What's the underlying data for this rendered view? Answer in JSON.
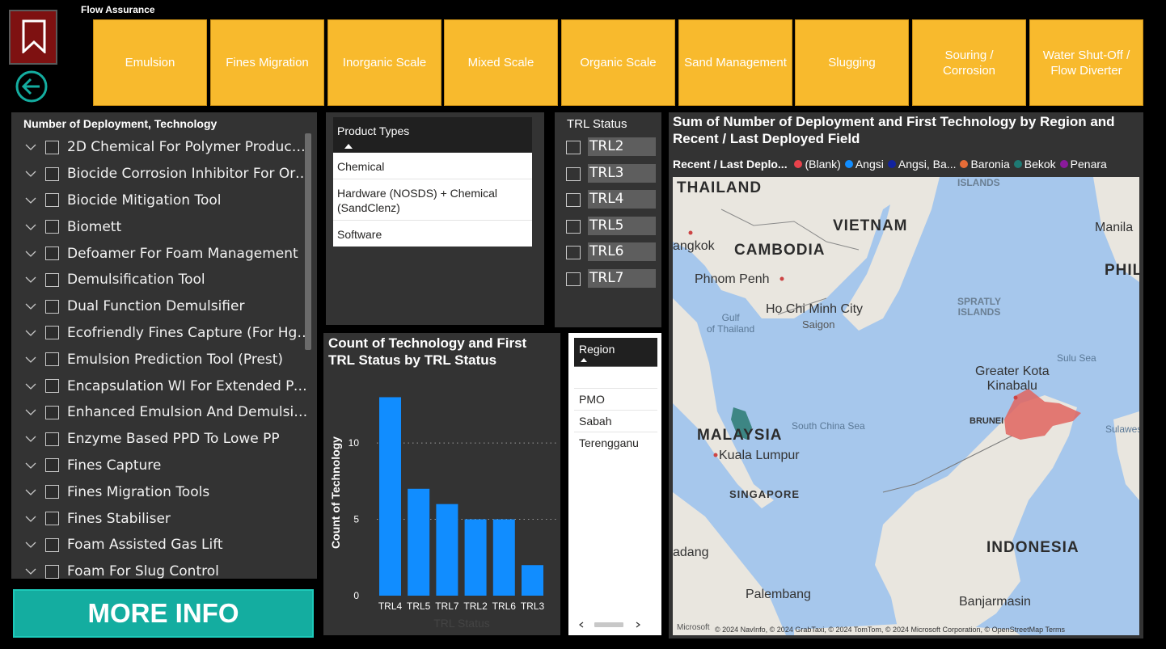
{
  "header": {
    "section_label": "Flow Assurance",
    "tiles": [
      "Emulsion",
      "Fines Migration",
      "Inorganic Scale",
      "Mixed Scale",
      "Organic Scale",
      "Sand Management",
      "Slugging",
      "Souring / Corrosion",
      "Water Shut-Off / Flow Diverter"
    ]
  },
  "icons": {
    "logo": "bookmark-icon",
    "back": "back-arrow-icon"
  },
  "colors": {
    "tile": "#f8ba2d",
    "accent": "#14ada0",
    "bar": "#118dff",
    "panel": "#333333"
  },
  "tech_slicer": {
    "title": "Number of Deployment, Technology",
    "items": [
      "2D Chemical For Polymer Produced ...",
      "Biocide Corrosion Inhibitor For Orga...",
      "Biocide Mitigation Tool",
      "Biomett",
      "Defoamer For Foam Management",
      "Demulsification Tool",
      "Dual Function Demulsifier",
      "Ecofriendly Fines Capture (For Hgs P...",
      "Emulsion Prediction Tool (Prest)",
      "Encapsulation WI For Extended Perf...",
      "Enhanced Emulsion And Demulsifica...",
      "Enzyme Based PPD To Lowe PP",
      "Fines Capture",
      "Fines Migration Tools",
      "Fines Stabiliser",
      "Foam Assisted Gas Lift",
      "Foam For Slug Control"
    ]
  },
  "more_info": {
    "label": "MORE INFO"
  },
  "product_types": {
    "header": "Product Types",
    "items": [
      "Chemical",
      "Hardware (NOSDS) + Chemical (SandClenz)",
      "Software"
    ]
  },
  "trl_status": {
    "title": "TRL Status",
    "items": [
      "TRL2",
      "TRL3",
      "TRL4",
      "TRL5",
      "TRL6",
      "TRL7"
    ]
  },
  "chart": {
    "title": "Count of Technology and First TRL Status by TRL Status"
  },
  "chart_data": {
    "type": "bar",
    "title": "Count of Technology and First TRL Status by TRL Status",
    "categories": [
      "TRL4",
      "TRL5",
      "TRL7",
      "TRL2",
      "TRL6",
      "TRL3"
    ],
    "values": [
      13,
      7,
      6,
      5,
      5,
      2
    ],
    "xlabel": "TRL Status",
    "ylabel": "Count of Technology",
    "ylim": [
      0,
      13.5
    ],
    "yticks": [
      0,
      5,
      10
    ],
    "grid": true
  },
  "region": {
    "header": "Region",
    "items": [
      "PMO",
      "Sabah",
      "Terengganu"
    ]
  },
  "map": {
    "title": "Sum of Number of Deployment and First Technology by Region and Recent / Last Deployed Field",
    "legend_title": "Recent / Last Deplo...",
    "legend": [
      {
        "label": "(Blank)",
        "color": "#e8424b"
      },
      {
        "label": "Angsi",
        "color": "#118dff"
      },
      {
        "label": "Angsi, Ba...",
        "color": "#12239e"
      },
      {
        "label": "Baronia",
        "color": "#e66c37"
      },
      {
        "label": "Bekok",
        "color": "#1e7a73"
      },
      {
        "label": "Penara",
        "color": "#8a1a9b"
      }
    ],
    "labels": {
      "thailand": "THAILAND",
      "vietnam": "VIETNAM",
      "cambodia": "CAMBODIA",
      "bangkok": "angkok",
      "phnom_penh": "Phnom Penh",
      "gulf": "Gulf\nof Thailand",
      "hcm": "Ho Chi Minh City",
      "saigon": "Saigon",
      "spratly": "SPRATLY\nISLANDS",
      "islands": "ISLANDS",
      "manila": "Manila",
      "phil": "PHIL",
      "sulu": "Sulu Sea",
      "kota": "Greater Kota\nKinabalu",
      "brunei": "BRUNEI",
      "scs": "South China Sea",
      "malaysia": "MALAYSIA",
      "kl": "Kuala Lumpur",
      "singapore": "SINGAPORE",
      "sulawesi": "Sulawesi",
      "padang": "adang",
      "indonesia": "INDONESIA",
      "palembang": "Palembang",
      "banjarmasin": "Banjarmasin",
      "microsoft": "Microsoft",
      "attribution": "© 2024 NavInfo, © 2024 GrabTaxi, © 2024 TomTom, © 2024 Microsoft Corporation, © OpenStreetMap  Terms"
    }
  }
}
